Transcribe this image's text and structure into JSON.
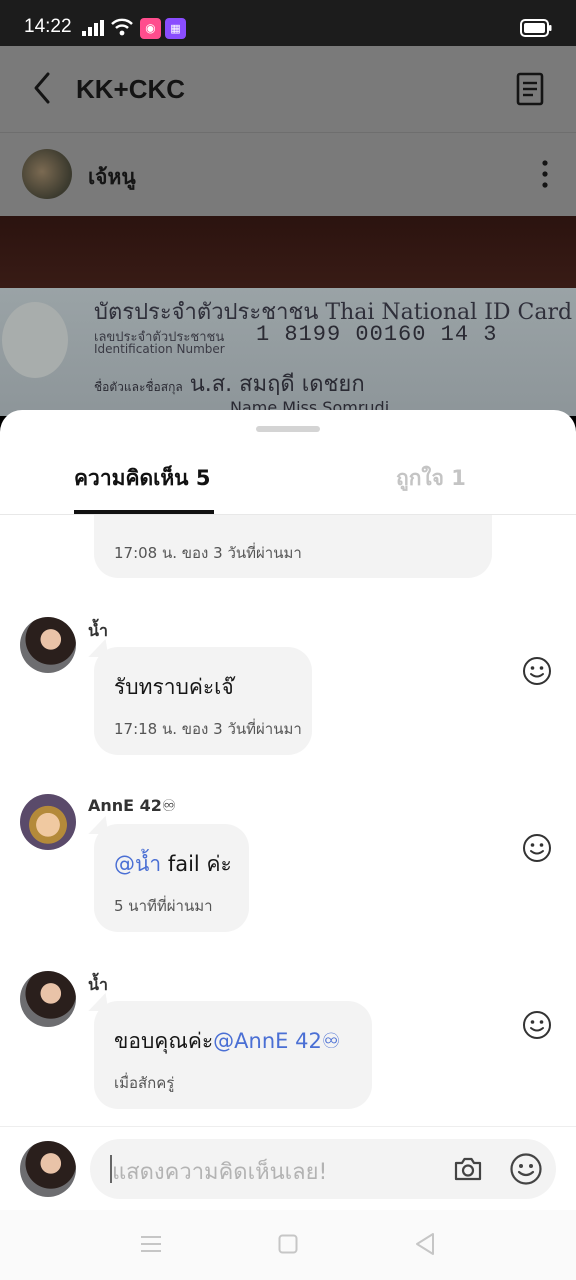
{
  "status_bar": {
    "time": "14:22",
    "app_icon_1": "pink-app-icon",
    "app_icon_2": "purple-app-icon"
  },
  "header": {
    "title": "KK+CKC",
    "back_icon": "chevron-left-icon",
    "doc_icon": "document-icon"
  },
  "post": {
    "author_name": "เจ้หนู",
    "more_icon": "more-vertical-icon"
  },
  "photo_card": {
    "title_th": "บัตรประจำตัวประชาชน Thai National ID Card",
    "id_label": "เลขประจำตัวประชาชน",
    "id_label_en": "Identification Number",
    "id_number": "1 8199 00160 14 3",
    "name_label": "ชื่อตัวและชื่อสกุล",
    "name_value": "น.ส. สมฤดี  เดชยก",
    "name_en": "Name  Miss Somrudi"
  },
  "tabs": {
    "comments": "ความคิดเห็น 5",
    "likes": "ถูกใจ 1"
  },
  "comments": [
    {
      "name": "",
      "text": "",
      "time": "17:08 น. ของ 3 วันที่ผ่านมา"
    },
    {
      "name": "น้ำ",
      "text": "รับทราบค่ะเจ๊",
      "time": "17:18 น. ของ 3 วันที่ผ่านมา"
    },
    {
      "name": "AnnE 42♾",
      "mention": "@น้ำ",
      "text": " fail ค่ะ",
      "time": "5 นาทีที่ผ่านมา"
    },
    {
      "name": "น้ำ",
      "text": "ขอบคุณค่ะ",
      "mention": "@AnnE 42♾",
      "time": "เมื่อสักครู่"
    }
  ],
  "input": {
    "placeholder": "แสดงความคิดเห็นเลย!",
    "camera_icon": "camera-icon",
    "emoji_icon": "emoji-icon"
  },
  "nav": {
    "menu_icon": "menu-icon",
    "home_icon": "home-square-icon",
    "back_icon": "back-triangle-icon"
  },
  "colors": {
    "mention": "#4a6fd4",
    "bubble": "#f3f3f3",
    "status_bar": "#1c1c1c"
  }
}
